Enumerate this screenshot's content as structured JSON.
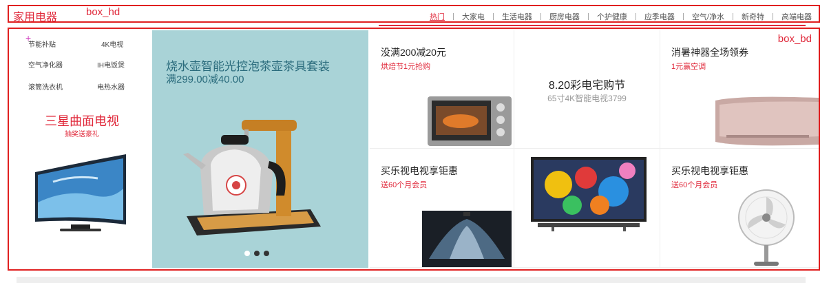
{
  "header": {
    "title": "家用电器",
    "box_label": "box_hd",
    "nav": [
      {
        "label": "热门",
        "active": true
      },
      {
        "label": "大家电",
        "active": false
      },
      {
        "label": "生活电器",
        "active": false
      },
      {
        "label": "厨房电器",
        "active": false
      },
      {
        "label": "个护健康",
        "active": false
      },
      {
        "label": "应季电器",
        "active": false
      },
      {
        "label": "空气/净水",
        "active": false
      },
      {
        "label": "新奇特",
        "active": false
      },
      {
        "label": "高端电器",
        "active": false
      }
    ]
  },
  "body": {
    "box_label": "box_bd",
    "left": {
      "categories": [
        "节能补贴",
        "4K电视",
        "空气净化器",
        "IH电饭煲",
        "滚筒洗衣机",
        "电热水器"
      ],
      "promo_title": "三星曲面电视",
      "promo_sub": "抽奖送豪礼"
    },
    "carousel": {
      "title": "烧水壶智能光控泡茶壶茶具套装",
      "subtitle": "满299.00减40.00",
      "dots": 3,
      "active_dot": 0
    },
    "tiles": {
      "oven": {
        "title": "没满200减20元",
        "sub": "烘焙节1元抢购"
      },
      "tv_festival": {
        "title": "8.20彩电宅购节",
        "sub": "65寸4K智能电视3799"
      },
      "aircon": {
        "title": "消暑神器全场领券",
        "sub": "1元赢空调"
      },
      "letv1": {
        "title": "买乐视电视享钜惠",
        "sub": "送60个月会员"
      },
      "fan": {
        "title": "买乐视电视享钜惠",
        "sub": "送60个月会员"
      }
    }
  },
  "colors": {
    "accent": "#e0283a",
    "carousel_bg": "#a9d3d7",
    "box_outline": "#e02020"
  }
}
